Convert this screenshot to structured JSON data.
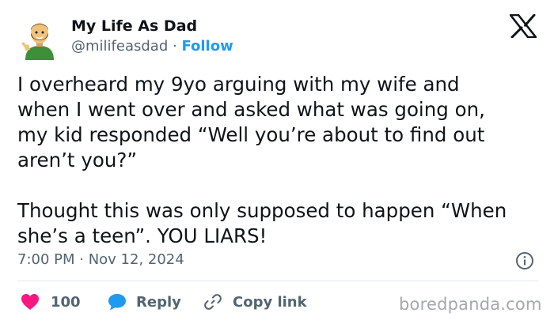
{
  "author": {
    "display_name": "My Life As Dad",
    "handle": "@milifeasdad",
    "separator": "·",
    "follow_label": "Follow"
  },
  "tweet": {
    "text": "I overheard my 9yo arguing with my wife and\nwhen I went over and asked what was going on,\nmy kid responded “Well you’re about to find out\naren’t you?”\n\nThought this was only supposed to happen “When\nshe’s a teen”. YOU LIARS!",
    "timestamp": "7:00 PM · Nov 12, 2024"
  },
  "actions": {
    "likes_count": "100",
    "reply_label": "Reply",
    "copy_link_label": "Copy link"
  },
  "watermark": "boredpanda.com",
  "colors": {
    "text": "#0f1419",
    "secondary": "#536471",
    "link_blue": "#1d9bf0",
    "like_pink": "#f91880",
    "reply_blue": "#1d9bf0",
    "divider": "#e1e8ed"
  },
  "icons": {
    "brand": "x-logo-icon",
    "info": "info-icon",
    "like": "heart-icon",
    "reply": "speech-bubble-icon",
    "copy": "link-icon"
  }
}
